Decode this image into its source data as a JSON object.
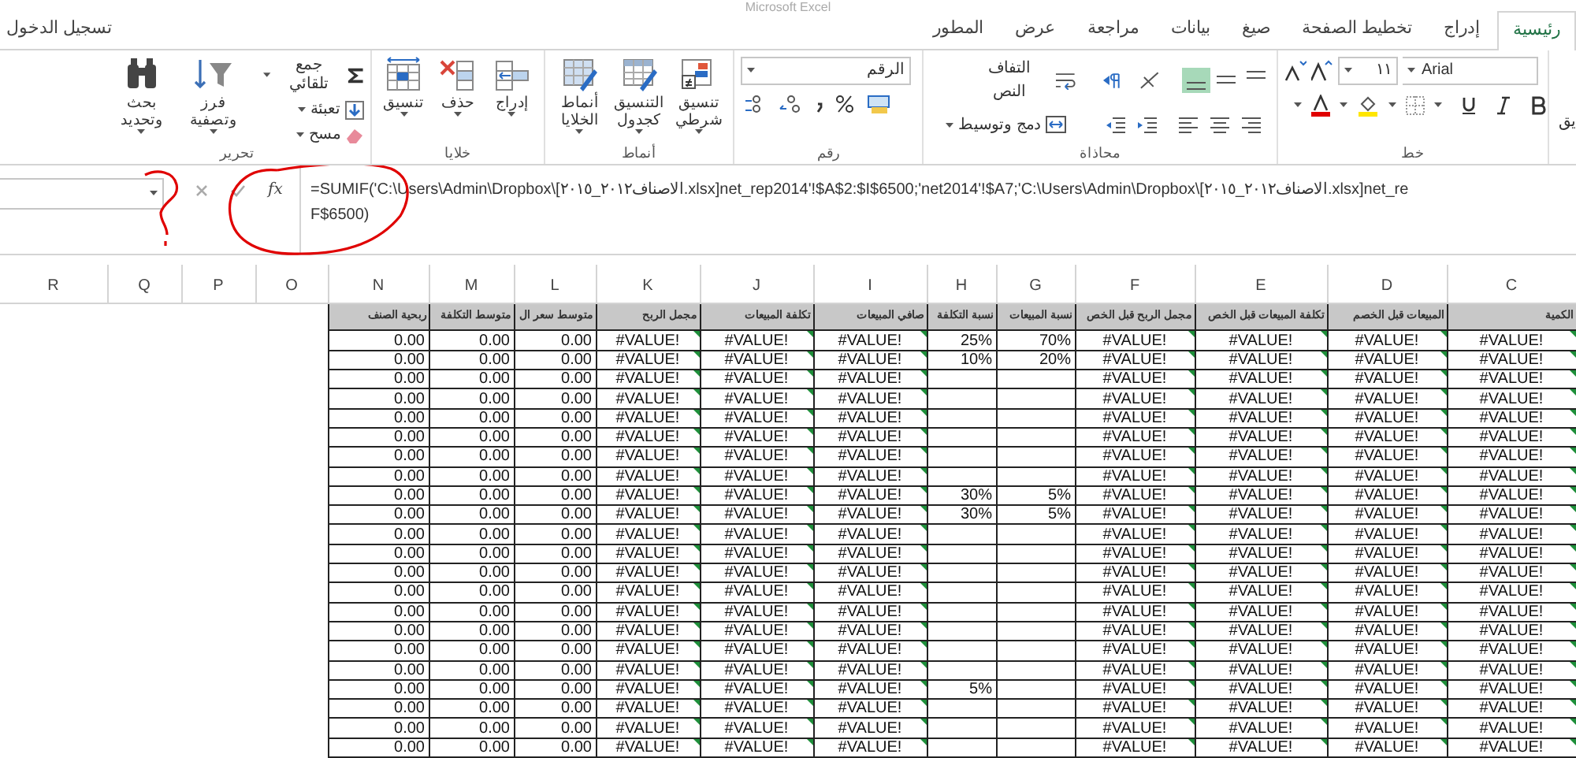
{
  "title_bar": {
    "title": "Microsoft Excel"
  },
  "sign_in": "تسجيل الدخول",
  "tabs": [
    {
      "label": "رئيسية",
      "selected": true
    },
    {
      "label": "إدراج",
      "selected": false
    },
    {
      "label": "تخطيط الصفحة",
      "selected": false
    },
    {
      "label": "صيغ",
      "selected": false
    },
    {
      "label": "بيانات",
      "selected": false
    },
    {
      "label": "مراجعة",
      "selected": false
    },
    {
      "label": "عرض",
      "selected": false
    },
    {
      "label": "المطور",
      "selected": false
    }
  ],
  "ribbon": {
    "editing": {
      "label": "تحرير",
      "find": "بحث وتحديد",
      "sort": "فرز وتصفية",
      "autosum": "جمع تلقائي",
      "fill": "تعبئة",
      "clear": "مسح"
    },
    "cells": {
      "label": "خلايا",
      "buttons": [
        "إدراج",
        "حذف",
        "تنسيق"
      ]
    },
    "styles": {
      "label": "أنماط",
      "buttons": [
        "تنسيق شرطي",
        "التنسيق كجدول",
        "أنماط الخلايا"
      ]
    },
    "number": {
      "label": "رقم",
      "format": "الرقم"
    },
    "alignment": {
      "label": "محاذاة",
      "wrap_text": "التفاف النص",
      "merge_center": "دمج وتوسيط",
      "vertical_align": [
        {
          "kind": "top",
          "selected": false
        },
        {
          "kind": "middle",
          "selected": false
        },
        {
          "kind": "bottom",
          "selected": true
        }
      ]
    },
    "font": {
      "label": "خط",
      "font_name": "Arial",
      "font_size": "١١"
    },
    "clipboard_partial": "يق"
  },
  "formula_bar": {
    "function_label": "fx",
    "lines": [
      "=SUMIF('C:\\Users\\Admin\\Dropbox\\[الاصناف٢٠١٢_٢٠١٥.xlsx]net_rep2014'!$A$2:$I$6500;'net2014'!$A7;'C:\\Users\\Admin\\Dropbox\\[الاصناف٢٠١٢_٢٠١٥.xlsx]net_re",
      "F$6500)"
    ]
  },
  "sheet": {
    "column_letters": [
      "R",
      "Q",
      "P",
      "O",
      "N",
      "M",
      "L",
      "K",
      "J",
      "I",
      "H",
      "G",
      "F",
      "E",
      "D",
      "C"
    ],
    "columns": [
      {
        "header": "ربحية الصنف",
        "kind": "number"
      },
      {
        "header": "متوسط التكلفة",
        "kind": "number"
      },
      {
        "header": "متوسط سعر ال",
        "kind": "number"
      },
      {
        "header": "مجمل الربح",
        "kind": "error"
      },
      {
        "header": "تكلفة المبيعات",
        "kind": "error"
      },
      {
        "header": "صافي المبيعات",
        "kind": "error"
      },
      {
        "header": "نسبة التكلفة",
        "kind": "number"
      },
      {
        "header": "نسبة المبيعات",
        "kind": "number"
      },
      {
        "header": "مجمل الربح قبل الخص",
        "kind": "error"
      },
      {
        "header": "تكلفة المبيعات قبل الخص",
        "kind": "error"
      },
      {
        "header": "المبيعات قبل الخصم",
        "kind": "error"
      },
      {
        "header": "الكمية",
        "kind": "error"
      }
    ],
    "rows": [
      [
        "0.00",
        "0.00",
        "0.00",
        "#VALUE!",
        "#VALUE!",
        "#VALUE!",
        "25%",
        "70%",
        "#VALUE!",
        "#VALUE!",
        "#VALUE!",
        "#VALUE!"
      ],
      [
        "0.00",
        "0.00",
        "0.00",
        "#VALUE!",
        "#VALUE!",
        "#VALUE!",
        "10%",
        "20%",
        "#VALUE!",
        "#VALUE!",
        "#VALUE!",
        "#VALUE!"
      ],
      [
        "0.00",
        "0.00",
        "0.00",
        "#VALUE!",
        "#VALUE!",
        "#VALUE!",
        null,
        null,
        "#VALUE!",
        "#VALUE!",
        "#VALUE!",
        "#VALUE!"
      ],
      [
        "0.00",
        "0.00",
        "0.00",
        "#VALUE!",
        "#VALUE!",
        "#VALUE!",
        null,
        null,
        "#VALUE!",
        "#VALUE!",
        "#VALUE!",
        "#VALUE!"
      ],
      [
        "0.00",
        "0.00",
        "0.00",
        "#VALUE!",
        "#VALUE!",
        "#VALUE!",
        null,
        null,
        "#VALUE!",
        "#VALUE!",
        "#VALUE!",
        "#VALUE!"
      ],
      [
        "0.00",
        "0.00",
        "0.00",
        "#VALUE!",
        "#VALUE!",
        "#VALUE!",
        null,
        null,
        "#VALUE!",
        "#VALUE!",
        "#VALUE!",
        "#VALUE!"
      ],
      [
        "0.00",
        "0.00",
        "0.00",
        "#VALUE!",
        "#VALUE!",
        "#VALUE!",
        null,
        null,
        "#VALUE!",
        "#VALUE!",
        "#VALUE!",
        "#VALUE!"
      ],
      [
        "0.00",
        "0.00",
        "0.00",
        "#VALUE!",
        "#VALUE!",
        "#VALUE!",
        null,
        null,
        "#VALUE!",
        "#VALUE!",
        "#VALUE!",
        "#VALUE!"
      ],
      [
        "0.00",
        "0.00",
        "0.00",
        "#VALUE!",
        "#VALUE!",
        "#VALUE!",
        "30%",
        "5%",
        "#VALUE!",
        "#VALUE!",
        "#VALUE!",
        "#VALUE!"
      ],
      [
        "0.00",
        "0.00",
        "0.00",
        "#VALUE!",
        "#VALUE!",
        "#VALUE!",
        "30%",
        "5%",
        "#VALUE!",
        "#VALUE!",
        "#VALUE!",
        "#VALUE!"
      ],
      [
        "0.00",
        "0.00",
        "0.00",
        "#VALUE!",
        "#VALUE!",
        "#VALUE!",
        null,
        null,
        "#VALUE!",
        "#VALUE!",
        "#VALUE!",
        "#VALUE!"
      ],
      [
        "0.00",
        "0.00",
        "0.00",
        "#VALUE!",
        "#VALUE!",
        "#VALUE!",
        null,
        null,
        "#VALUE!",
        "#VALUE!",
        "#VALUE!",
        "#VALUE!"
      ],
      [
        "0.00",
        "0.00",
        "0.00",
        "#VALUE!",
        "#VALUE!",
        "#VALUE!",
        null,
        null,
        "#VALUE!",
        "#VALUE!",
        "#VALUE!",
        "#VALUE!"
      ],
      [
        "0.00",
        "0.00",
        "0.00",
        "#VALUE!",
        "#VALUE!",
        "#VALUE!",
        null,
        null,
        "#VALUE!",
        "#VALUE!",
        "#VALUE!",
        "#VALUE!"
      ],
      [
        "0.00",
        "0.00",
        "0.00",
        "#VALUE!",
        "#VALUE!",
        "#VALUE!",
        null,
        null,
        "#VALUE!",
        "#VALUE!",
        "#VALUE!",
        "#VALUE!"
      ],
      [
        "0.00",
        "0.00",
        "0.00",
        "#VALUE!",
        "#VALUE!",
        "#VALUE!",
        null,
        null,
        "#VALUE!",
        "#VALUE!",
        "#VALUE!",
        "#VALUE!"
      ],
      [
        "0.00",
        "0.00",
        "0.00",
        "#VALUE!",
        "#VALUE!",
        "#VALUE!",
        null,
        null,
        "#VALUE!",
        "#VALUE!",
        "#VALUE!",
        "#VALUE!"
      ],
      [
        "0.00",
        "0.00",
        "0.00",
        "#VALUE!",
        "#VALUE!",
        "#VALUE!",
        null,
        null,
        "#VALUE!",
        "#VALUE!",
        "#VALUE!",
        "#VALUE!"
      ],
      [
        "0.00",
        "0.00",
        "0.00",
        "#VALUE!",
        "#VALUE!",
        "#VALUE!",
        "5%",
        null,
        "#VALUE!",
        "#VALUE!",
        "#VALUE!",
        "#VALUE!"
      ],
      [
        "0.00",
        "0.00",
        "0.00",
        "#VALUE!",
        "#VALUE!",
        "#VALUE!",
        null,
        null,
        "#VALUE!",
        "#VALUE!",
        "#VALUE!",
        "#VALUE!"
      ],
      [
        "0.00",
        "0.00",
        "0.00",
        "#VALUE!",
        "#VALUE!",
        "#VALUE!",
        null,
        null,
        "#VALUE!",
        "#VALUE!",
        "#VALUE!",
        "#VALUE!"
      ],
      [
        "0.00",
        "0.00",
        "0.00",
        "#VALUE!",
        "#VALUE!",
        "#VALUE!",
        null,
        null,
        "#VALUE!",
        "#VALUE!",
        "#VALUE!",
        "#VALUE!"
      ]
    ]
  }
}
